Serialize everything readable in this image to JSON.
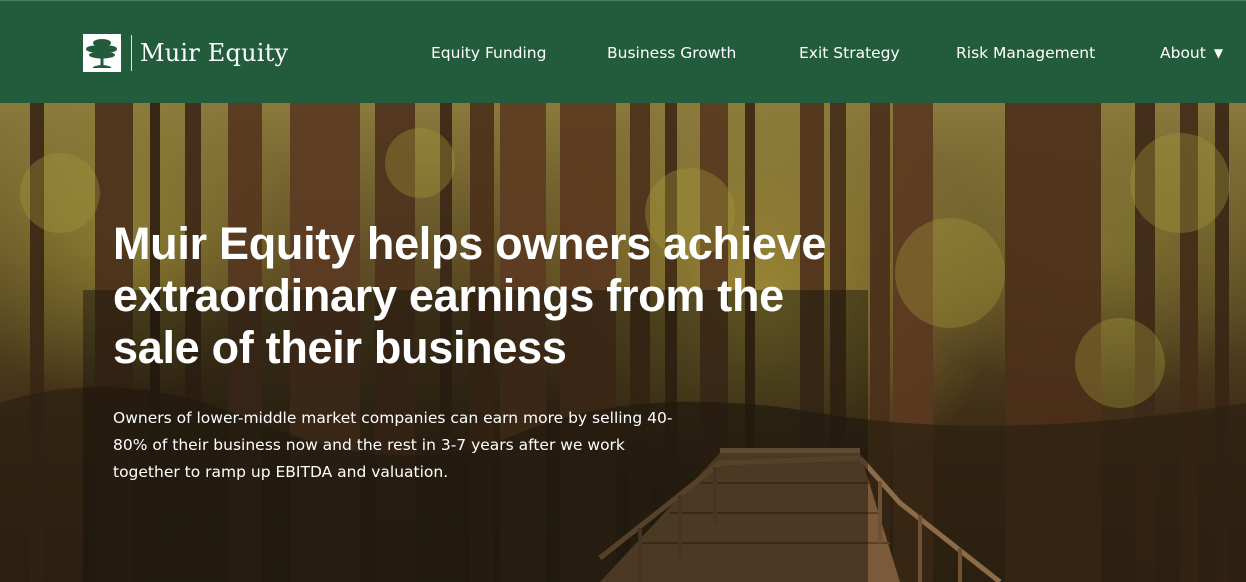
{
  "header": {
    "logo_text": "Muir Equity",
    "logo_icon": "tree-icon",
    "background_color": "#225c3d"
  },
  "nav": {
    "items": [
      {
        "label": "Equity Funding"
      },
      {
        "label": "Business Growth"
      },
      {
        "label": "Exit Strategy"
      },
      {
        "label": "Risk Management"
      },
      {
        "label": "About",
        "icon": "caret-down-icon",
        "caret": "▼"
      }
    ]
  },
  "hero": {
    "title": "Muir Equity helps owners achieve extraordinary earnings from the sale of their business",
    "subtitle": "Owners of lower-middle market companies can earn more by selling 40-80% of their business now and the rest in 3-7 years after we work together to ramp up EBITDA and valuation.",
    "background_image": "forest-boardwalk-image"
  }
}
